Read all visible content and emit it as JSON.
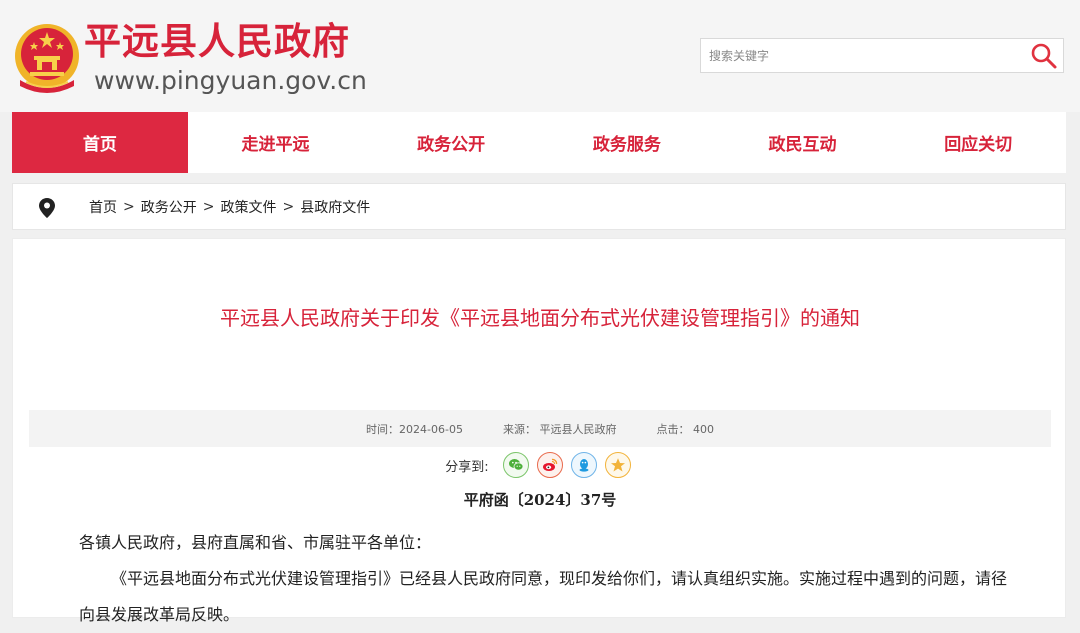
{
  "site": {
    "title": "平远县人民政府",
    "url": "www.pingyuan.gov.cn"
  },
  "search": {
    "placeholder": "搜索关键字",
    "icon": "search-icon"
  },
  "nav": {
    "items": [
      {
        "label": "首页",
        "active": true
      },
      {
        "label": "走进平远",
        "active": false
      },
      {
        "label": "政务公开",
        "active": false
      },
      {
        "label": "政务服务",
        "active": false
      },
      {
        "label": "政民互动",
        "active": false
      },
      {
        "label": "回应关切",
        "active": false
      }
    ]
  },
  "breadcrumb": {
    "icon": "location-pin-icon",
    "items": [
      "首页",
      "政务公开",
      "政策文件",
      "县政府文件"
    ],
    "separator": ">"
  },
  "article": {
    "title": "平远县人民政府关于印发《平远县地面分布式光伏建设管理指引》的通知",
    "meta": {
      "time": "时间：2024-06-05",
      "source": "来源：  平远县人民政府",
      "clicks": "点击：  400"
    },
    "share_label": "分享到:",
    "share_targets": [
      "wechat-icon",
      "weibo-icon",
      "qq-icon",
      "favorite-star-icon"
    ],
    "doc_number": "平府函〔2024〕37号",
    "paragraphs": [
      "各镇人民政府，县府直属和省、市属驻平各单位：",
      "《平远县地面分布式光伏建设管理指引》已经县人民政府同意，现印发给你们，请认真组织实施。实施过程中遇到的问题，请径向县发展改革局反映。"
    ]
  },
  "colors": {
    "brand_red": "#d7233a",
    "nav_active_bg": "#dd2841",
    "accent_orange": "#f39a2b"
  }
}
